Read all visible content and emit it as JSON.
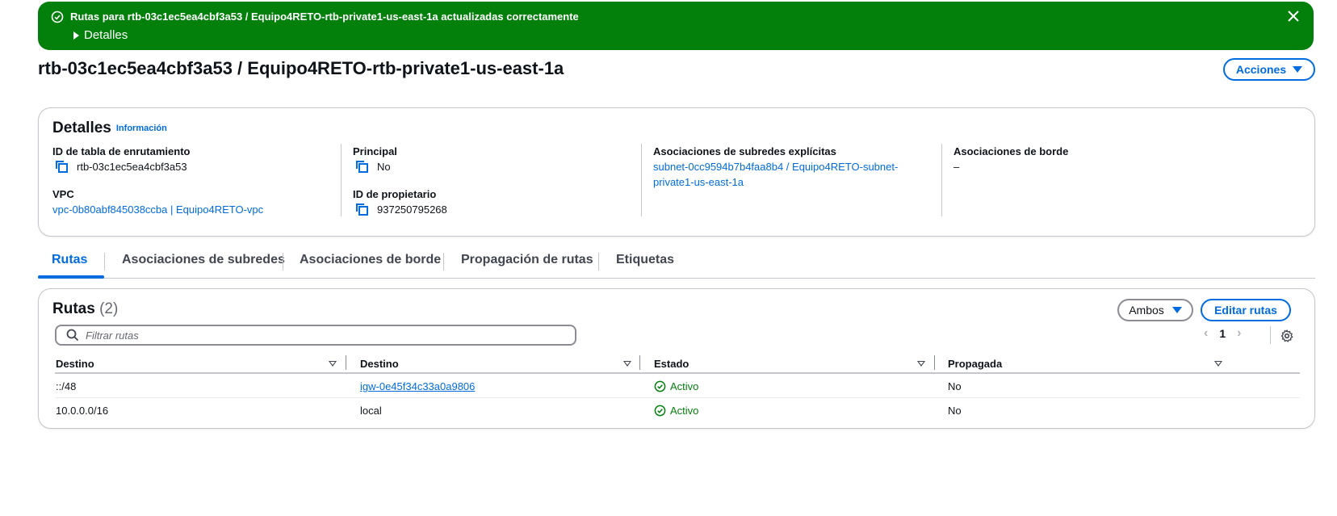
{
  "flash": {
    "message": "Rutas para rtb-03c1ec5ea4cbf3a53 / Equipo4RETO-rtb-private1-us-east-1a actualizadas correctamente",
    "details_label": "Detalles",
    "color": "#037f0c",
    "icons": [
      "check-circle-icon",
      "close-icon",
      "caret-right-icon"
    ]
  },
  "header": {
    "title": "rtb-03c1ec5ea4cbf3a53 / Equipo4RETO-rtb-private1-us-east-1a",
    "actions_label": "Acciones"
  },
  "details": {
    "heading": "Detalles",
    "info_link": "Información",
    "route_table_id": {
      "label": "ID de tabla de enrutamiento",
      "value": "rtb-03c1ec5ea4cbf3a53"
    },
    "vpc": {
      "label": "VPC",
      "value": "vpc-0b80abf845038ccba | Equipo4RETO-vpc"
    },
    "main": {
      "label": "Principal",
      "value": "No"
    },
    "owner_id": {
      "label": "ID de propietario",
      "value": "937250795268"
    },
    "subnet_assoc": {
      "label": "Asociaciones de subredes explícitas",
      "value_line1": "subnet-0cc9594b7b4faa8b4 / Equipo4RETO-subnet-",
      "value_line2": "private1-us-east-1a"
    },
    "edge_assoc": {
      "label": "Asociaciones de borde",
      "value": "–"
    }
  },
  "tabs": [
    {
      "label": "Rutas",
      "active": true
    },
    {
      "label": "Asociaciones de subredes",
      "active": false
    },
    {
      "label": "Asociaciones de borde",
      "active": false
    },
    {
      "label": "Propagación de rutas",
      "active": false
    },
    {
      "label": "Etiquetas",
      "active": false
    }
  ],
  "routes": {
    "heading": "Rutas",
    "count": "(2)",
    "filter_button": "Ambos",
    "edit_button": "Editar rutas",
    "search_placeholder": "Filtrar rutas",
    "page": "1",
    "columns": [
      "Destino",
      "Destino",
      "Estado",
      "Propagada"
    ],
    "rows": [
      {
        "destination": "::/48",
        "target": "igw-0e45f34c33a0a9806",
        "target_is_link": true,
        "status": "Activo",
        "propagated": "No"
      },
      {
        "destination": "10.0.0.0/16",
        "target": "local",
        "target_is_link": false,
        "status": "Activo",
        "propagated": "No"
      }
    ]
  },
  "colors": {
    "link": "#006ce0",
    "success": "#037f0c",
    "border": "#c6c6cd"
  }
}
